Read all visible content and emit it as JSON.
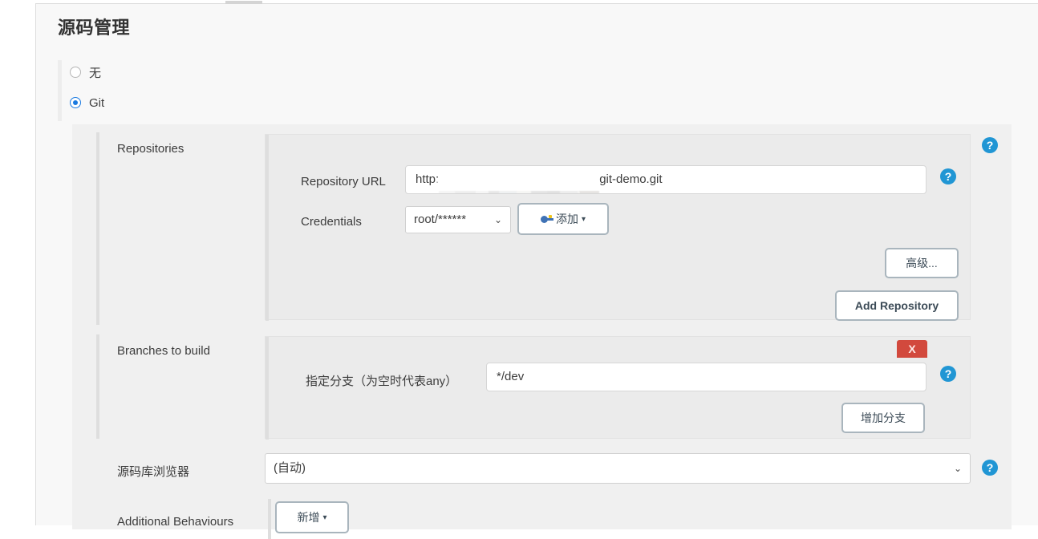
{
  "page": {
    "title": "源码管理"
  },
  "scm_type": {
    "options": [
      {
        "label": "无",
        "selected": false
      },
      {
        "label": "Git",
        "selected": true
      }
    ]
  },
  "repositories": {
    "label": "Repositories",
    "repository_url": {
      "label": "Repository URL",
      "value_prefix": "http:",
      "value_suffix": "git-demo.git",
      "redacted": true
    },
    "credentials": {
      "label": "Credentials",
      "selected": "root/******",
      "add_button": "添加"
    },
    "advanced_button": "高级...",
    "add_repository_button": "Add Repository"
  },
  "branches": {
    "label": "Branches to build",
    "branch_specifier": {
      "label": "指定分支（为空时代表any）",
      "value": "*/dev"
    },
    "delete_button": "X",
    "add_branch_button": "增加分支"
  },
  "repository_browser": {
    "label": "源码库浏览器",
    "selected": "(自动)"
  },
  "additional_behaviours": {
    "label": "Additional Behaviours",
    "add_button": "新增"
  },
  "icons": {
    "help": "?",
    "chevron_down": "⌄",
    "caret_down": "▾"
  },
  "colors": {
    "accent_blue": "#1b7ae0",
    "help_blue": "#2196d4",
    "danger_red": "#d2493d",
    "panel_bg": "#f0f0f0",
    "inner_panel_bg": "#ebebeb"
  }
}
